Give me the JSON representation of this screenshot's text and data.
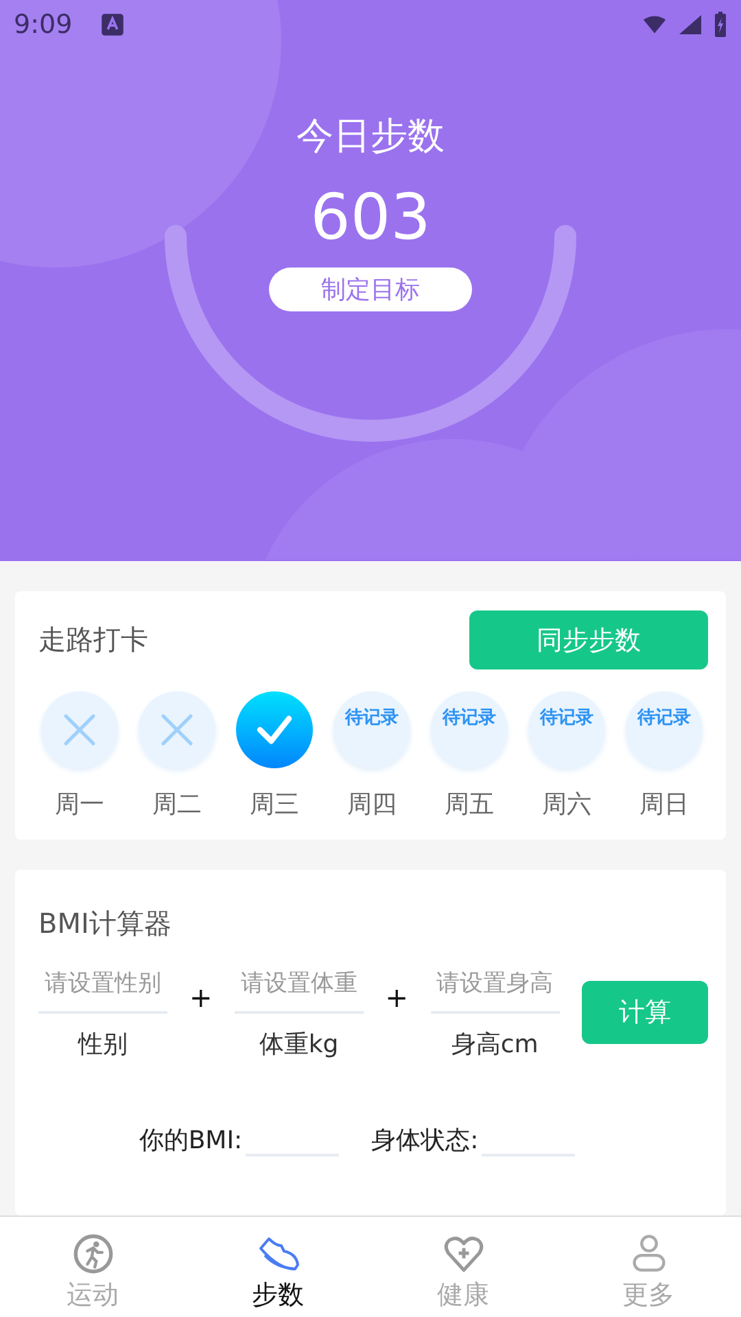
{
  "status_bar": {
    "time": "9:09"
  },
  "header": {
    "title": "今日步数",
    "steps": "603",
    "goal_button": "制定目标"
  },
  "checkin": {
    "title": "走路打卡",
    "sync_button": "同步步数",
    "days": [
      {
        "label": "周一",
        "kind": "missed"
      },
      {
        "label": "周二",
        "kind": "missed"
      },
      {
        "label": "周三",
        "kind": "done"
      },
      {
        "label": "周四",
        "kind": "pending",
        "badge": "待记录"
      },
      {
        "label": "周五",
        "kind": "pending",
        "badge": "待记录"
      },
      {
        "label": "周六",
        "kind": "pending",
        "badge": "待记录"
      },
      {
        "label": "周日",
        "kind": "pending",
        "badge": "待记录"
      }
    ]
  },
  "bmi": {
    "title": "BMI计算器",
    "operator": "+",
    "calc_button": "计算",
    "fields": [
      {
        "placeholder": "请设置性别",
        "label": "性别"
      },
      {
        "placeholder": "请设置体重",
        "label": "体重kg"
      },
      {
        "placeholder": "请设置身高",
        "label": "身高cm"
      }
    ],
    "results": [
      {
        "label": "你的BMI:"
      },
      {
        "label": "身体状态:"
      }
    ]
  },
  "tabs": [
    {
      "label": "运动",
      "kind": "run",
      "selected": false
    },
    {
      "label": "步数",
      "kind": "shoe",
      "selected": true
    },
    {
      "label": "健康",
      "kind": "heart",
      "selected": false
    },
    {
      "label": "更多",
      "kind": "person",
      "selected": false
    }
  ]
}
